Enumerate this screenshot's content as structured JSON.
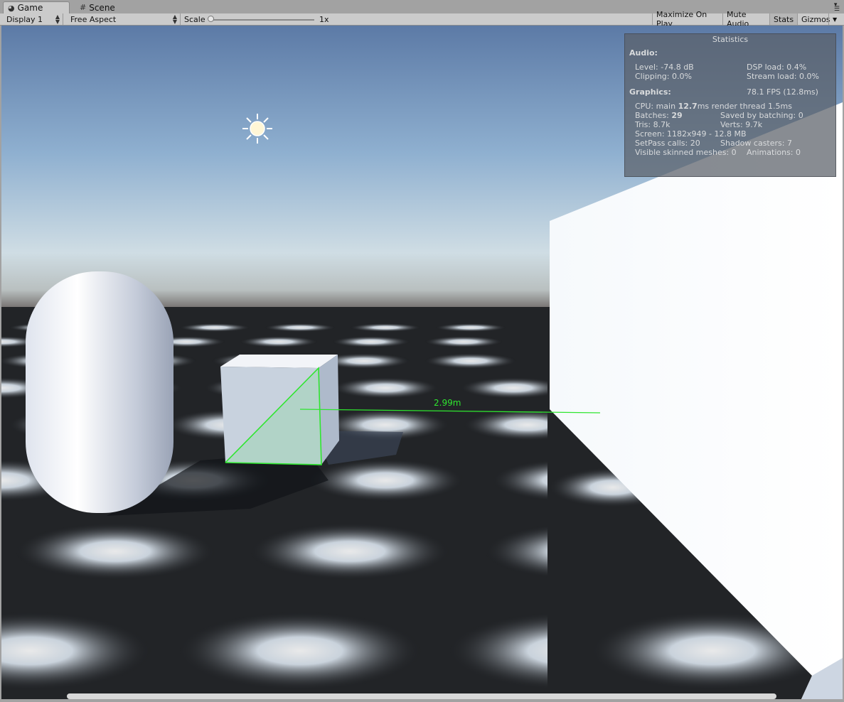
{
  "tabs": [
    {
      "label": "Game",
      "icon": "pacman-icon",
      "active": true
    },
    {
      "label": "Scene",
      "icon": "grid-hash-icon",
      "active": false
    }
  ],
  "toolbar": {
    "display": "Display 1",
    "aspect": "Free Aspect",
    "scale_label": "Scale",
    "scale_value": "1x",
    "scale_fraction": 0.0,
    "maximize": "Maximize On Play",
    "mute": "Mute Audio",
    "stats": "Stats",
    "gizmos": "Gizmos"
  },
  "stats": {
    "title": "Statistics",
    "audio_header": "Audio:",
    "level": "Level: -74.8 dB",
    "dsp": "DSP load: 0.4%",
    "clipping": "Clipping: 0.0%",
    "stream": "Stream load: 0.0%",
    "graphics_header": "Graphics:",
    "fps": "78.1 FPS (12.8ms)",
    "cpu_prefix": "CPU: main ",
    "cpu_main": "12.7",
    "cpu_suffix": "ms  render thread 1.5ms",
    "batches_prefix": "Batches: ",
    "batches": "29",
    "saved_batching": "Saved by batching: 0",
    "tris": "Tris: 8.7k",
    "verts": "Verts: 9.7k",
    "screen": "Screen: 1182x949 - 12.8 MB",
    "setpass": "SetPass calls: 20",
    "shadow": "Shadow casters: 7",
    "skinned": "Visible skinned meshes: 0",
    "animations": "Animations: 0"
  },
  "scene": {
    "measurement": "2.99m",
    "sky_top": "#5b7aa8",
    "sky_horizon": "#d8e2e6",
    "floor": "#222427",
    "measure_color": "#2fe62f"
  }
}
